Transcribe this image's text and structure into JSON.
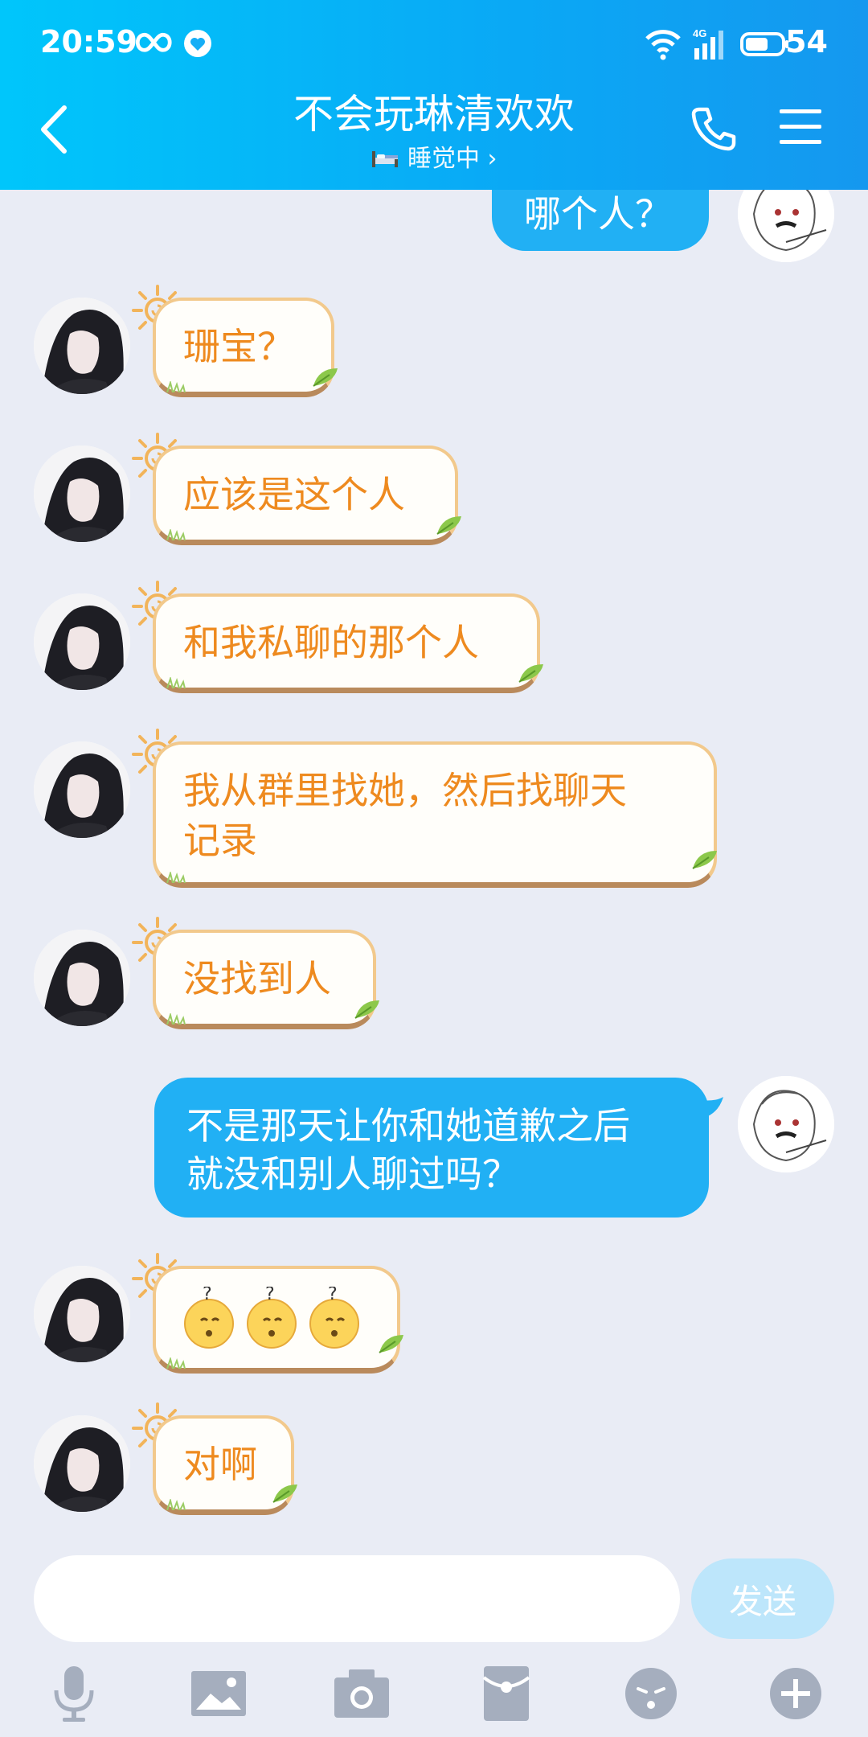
{
  "status": {
    "time": "20:59",
    "battery": "54",
    "network": "4G"
  },
  "header": {
    "title": "不会玩琳清欢欢",
    "subtitle": "睡觉中",
    "subtitle_arrow": "›"
  },
  "messages": [
    {
      "side": "out",
      "text": "哪个人？"
    },
    {
      "side": "in",
      "text": "珊宝？"
    },
    {
      "side": "in",
      "text": "应该是这个人"
    },
    {
      "side": "in",
      "text": "和我私聊的那个人"
    },
    {
      "side": "in",
      "line1": "我从群里找她，然后找聊天",
      "line2": "记录"
    },
    {
      "side": "in",
      "text": "没找到人"
    },
    {
      "side": "out",
      "line1": "不是那天让你和她道歉之后",
      "line2": "就没和别人聊过吗？"
    },
    {
      "side": "in",
      "emoji": [
        "confused-face",
        "confused-face",
        "confused-face"
      ]
    },
    {
      "side": "in",
      "text": "对啊"
    }
  ],
  "input": {
    "placeholder": "",
    "send_label": "发送"
  },
  "toolbar": [
    "voice",
    "image",
    "camera",
    "red-packet",
    "emoji",
    "more"
  ],
  "colors": {
    "header": "#12aaf5",
    "out_bubble": "#21b0f4",
    "in_text": "#ee8a1f",
    "background": "#e9ecf5"
  }
}
